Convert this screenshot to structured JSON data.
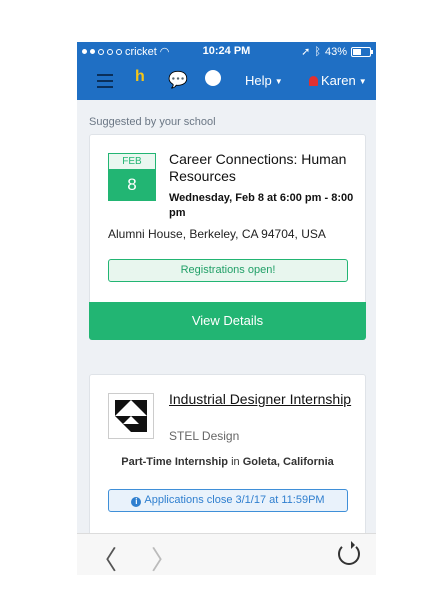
{
  "status_bar": {
    "carrier": "cricket",
    "time": "10:24 PM",
    "battery": "43%"
  },
  "nav": {
    "help_label": "Help",
    "user_label": "Karen",
    "logo_text": "h"
  },
  "section_label": "Suggested by your school",
  "event": {
    "month": "FEB",
    "day": "8",
    "title": "Career Connections: Human Resources",
    "when": "Wednesday, Feb 8 at 6:00 pm - 8:00 pm",
    "location": "Alumni House, Berkeley, CA 94704, USA",
    "registration_status": "Registrations open!",
    "button_label": "View Details"
  },
  "job": {
    "title": "Industrial Designer Internship",
    "company": "STEL Design",
    "type": "Part-Time Internship",
    "in_word": "in",
    "location": "Goleta, California",
    "deadline": "Applications close 3/1/17 at 11:59PM"
  },
  "colors": {
    "primary_blue": "#1f6fc4",
    "accent_green": "#22b573",
    "info_blue": "#2f7fcf"
  },
  "icons": [
    "menu-icon",
    "handshake-logo-icon",
    "chat-icon",
    "globe-icon",
    "bell-icon",
    "back-icon",
    "forward-icon",
    "reload-icon"
  ]
}
